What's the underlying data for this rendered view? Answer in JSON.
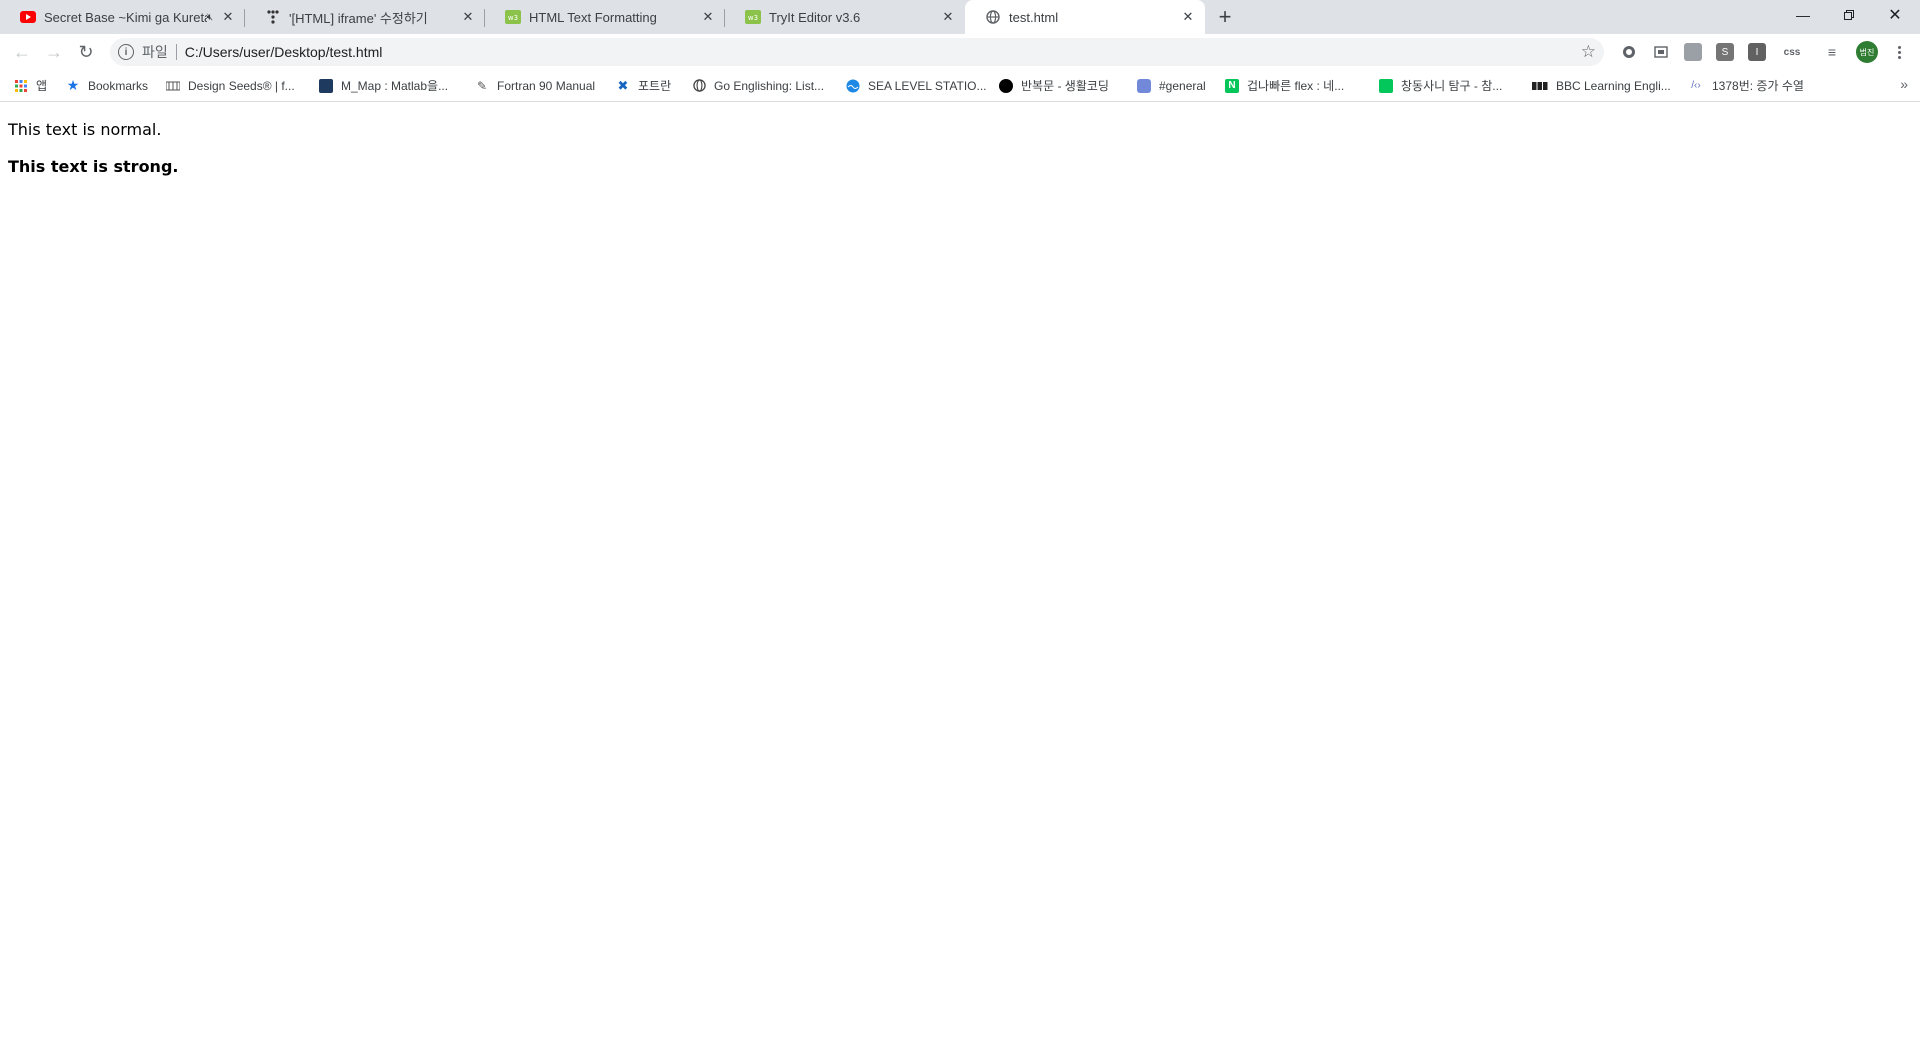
{
  "tabs": [
    {
      "title": "Secret Base ~Kimi ga Kureta",
      "favicon": "youtube-icon",
      "muted": true
    },
    {
      "title": "'[HTML] iframe' 수정하기",
      "favicon": "tistory-icon"
    },
    {
      "title": "HTML Text Formatting",
      "favicon": "w3schools-icon"
    },
    {
      "title": "TryIt Editor v3.6",
      "favicon": "w3schools-icon"
    },
    {
      "title": "test.html",
      "favicon": "globe-icon",
      "active": true
    }
  ],
  "omnibox": {
    "scheme_label": "파일",
    "url": "C:/Users/user/Desktop/test.html"
  },
  "avatar_label": "범진",
  "extensions": [
    {
      "name": "extension-circle-icon"
    },
    {
      "name": "extension-screen-icon"
    },
    {
      "name": "extension-gray-icon"
    },
    {
      "name": "extension-s-icon",
      "label": "S"
    },
    {
      "name": "extension-i-icon",
      "label": "I"
    },
    {
      "name": "extension-css-icon",
      "label": "css"
    }
  ],
  "bookmarks": [
    {
      "label": "앱",
      "icon": "apps-grid-icon"
    },
    {
      "label": "Bookmarks",
      "icon": "star-icon"
    },
    {
      "label": "Design Seeds® | f...",
      "icon": "designseeds-icon"
    },
    {
      "label": "M_Map : Matlab을...",
      "icon": "mmap-icon"
    },
    {
      "label": "Fortran 90 Manual",
      "icon": "fortran-icon"
    },
    {
      "label": "포트란",
      "icon": "tool-icon"
    },
    {
      "label": "Go Englishing: List...",
      "icon": "globe-icon"
    },
    {
      "label": "SEA LEVEL STATIO...",
      "icon": "sealevel-icon"
    },
    {
      "label": "반복문 - 생활코딩",
      "icon": "black-circle-icon"
    },
    {
      "label": "#general",
      "icon": "discord-icon"
    },
    {
      "label": "겁나빠른 flex : 네...",
      "icon": "naver-icon"
    },
    {
      "label": "창동사니 탐구 - 참...",
      "icon": "blog-icon"
    },
    {
      "label": "BBC Learning Engli...",
      "icon": "bbc-icon"
    },
    {
      "label": "1378번: 증가 수열",
      "icon": "code-icon"
    }
  ],
  "page": {
    "normal_text": "This text is normal.",
    "strong_text": "This text is strong."
  },
  "colors": {
    "tabstrip": "#dee1e6",
    "omnibox": "#f1f3f4",
    "youtube_red": "#ff0000",
    "w3_green": "#8bc34a",
    "avatar_green": "#2e7d32"
  }
}
